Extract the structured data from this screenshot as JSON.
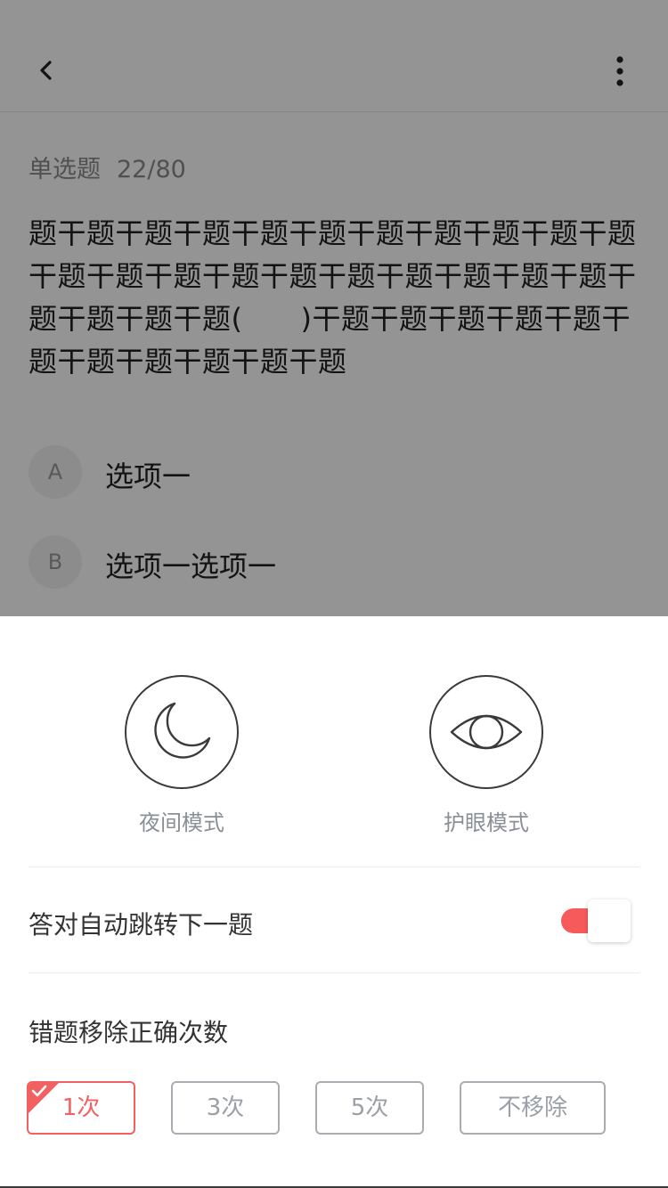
{
  "question": {
    "type_label": "单选题",
    "progress": "22/80",
    "stem": "题干题干题干题干题干题干题干题干题干题干题干题干题干题干题干题干题干题干题干题干题干题干题干题干题(　　)干题干题干题干题干题干题干题干题干题干题干题",
    "options": [
      {
        "letter": "A",
        "text": "选项一"
      },
      {
        "letter": "B",
        "text": "选项一选项一"
      }
    ]
  },
  "settings": {
    "modes": [
      {
        "label": "夜间模式",
        "icon": "moon-icon"
      },
      {
        "label": "护眼模式",
        "icon": "eye-icon"
      }
    ],
    "auto_next_label": "答对自动跳转下一题",
    "auto_next_enabled": true,
    "remove_label": "错题移除正确次数",
    "remove_options": [
      "1次",
      "3次",
      "5次",
      "不移除"
    ],
    "remove_selected": "1次"
  },
  "colors": {
    "accent": "#f26161",
    "overlay": "rgba(0,0,0,0.42)"
  }
}
